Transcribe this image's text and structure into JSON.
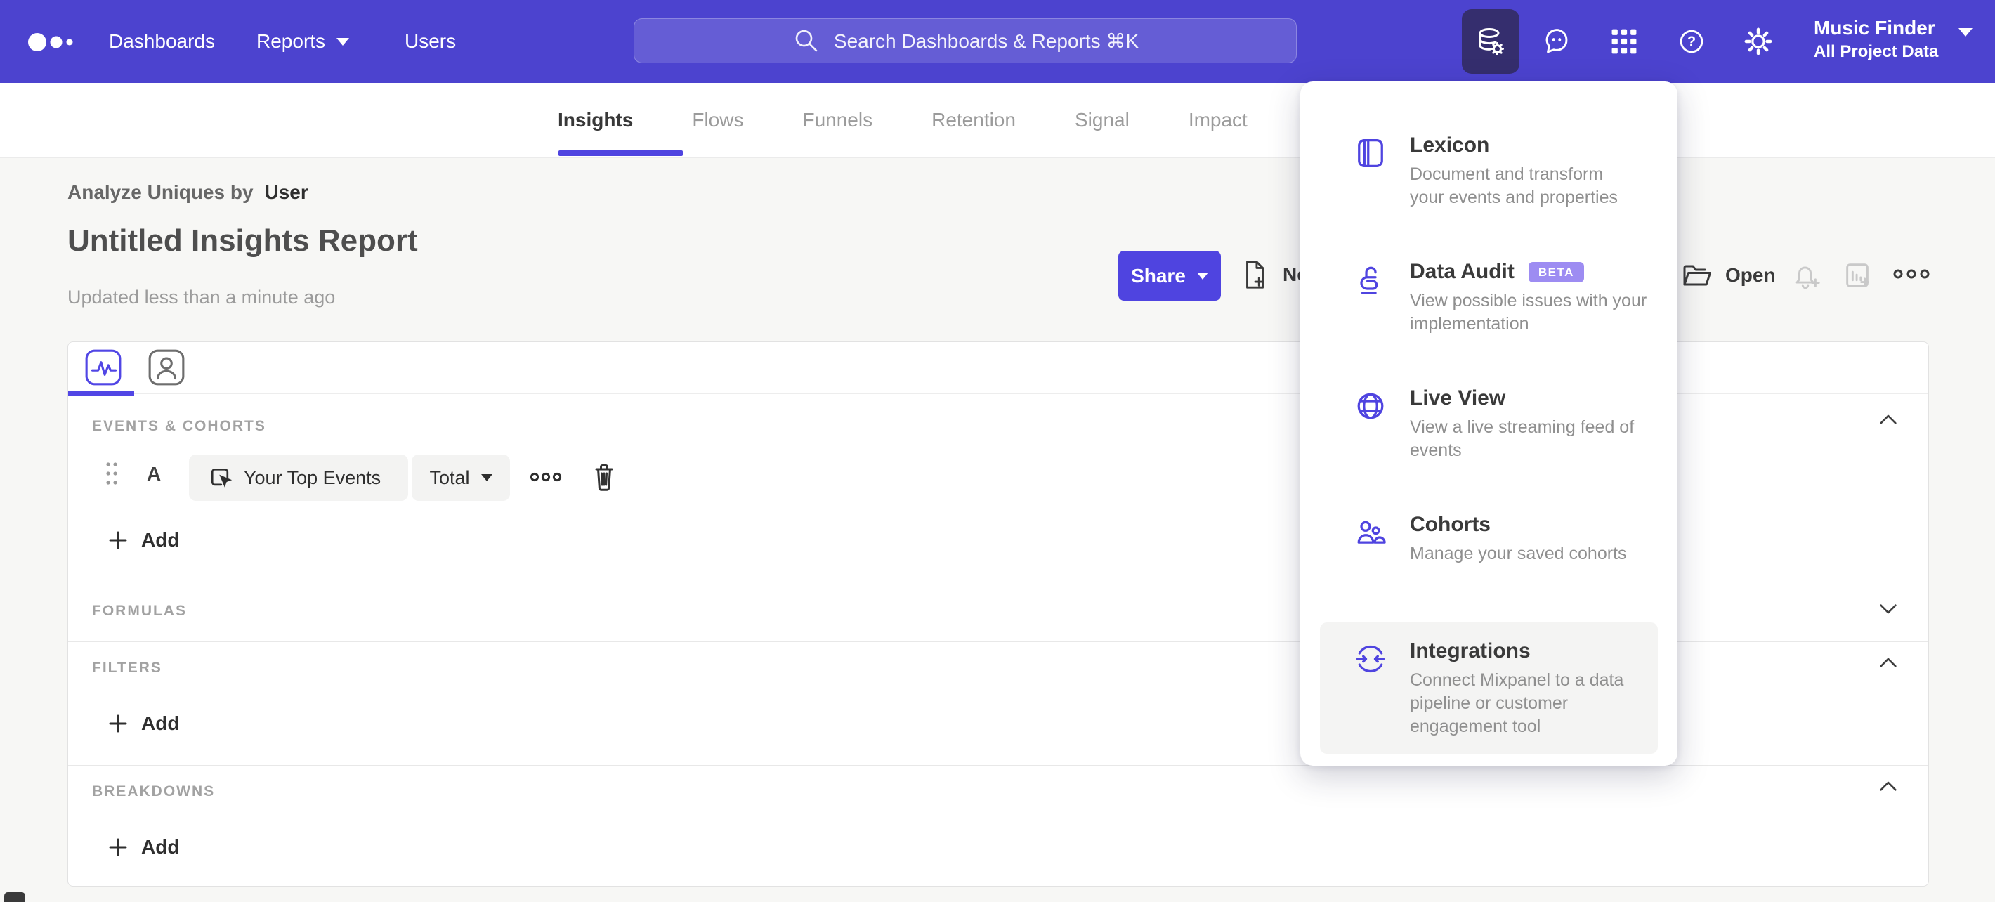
{
  "navbar": {
    "menu": [
      {
        "label": "Dashboards"
      },
      {
        "label": "Reports"
      },
      {
        "label": "Users"
      }
    ],
    "search": {
      "placeholder": "Search Dashboards & Reports ⌘K"
    },
    "project": {
      "name": "Music Finder",
      "scope": "All Project Data"
    }
  },
  "tabs": [
    {
      "label": "Insights"
    },
    {
      "label": "Flows"
    },
    {
      "label": "Funnels"
    },
    {
      "label": "Retention"
    },
    {
      "label": "Signal"
    },
    {
      "label": "Impact"
    }
  ],
  "report": {
    "analyze_label": "Analyze Uniques by",
    "analyze_value": "User",
    "title": "Untitled Insights Report",
    "updated": "Updated less than a minute ago",
    "share_label": "Share",
    "new_label": "New",
    "open_label": "Open"
  },
  "builder": {
    "sections": [
      {
        "label": "EVENTS & COHORTS"
      },
      {
        "label": "FORMULAS"
      },
      {
        "label": "FILTERS"
      },
      {
        "label": "BREAKDOWNS"
      }
    ],
    "event_row": {
      "series_letter": "A",
      "event_name": "Your Top Events",
      "metric": "Total"
    },
    "add_label": "Add"
  },
  "menu_panel": {
    "items": [
      {
        "icon": "lexicon-icon",
        "title": "Lexicon",
        "description": "Document and transform\nyour events and properties"
      },
      {
        "icon": "data-audit-icon",
        "title": "Data Audit",
        "badge": "BETA",
        "description": "View possible issues with your\nimplementation"
      },
      {
        "icon": "live-view-icon",
        "title": "Live View",
        "description": "View a live streaming feed of\nevents"
      },
      {
        "icon": "cohorts-icon",
        "title": "Cohorts",
        "description": "Manage your saved cohorts"
      },
      {
        "icon": "integrations-icon",
        "title": "Integrations",
        "description": "Connect Mixpanel to a data\npipeline or customer\nengagement tool"
      }
    ]
  },
  "colors": {
    "nav_background": "#4C43CF",
    "accent_purple": "#4F44E0",
    "active_nav_button": "#352E6E",
    "beta_badge": "#9D8CF2",
    "page_background": "#f7f7f5"
  }
}
